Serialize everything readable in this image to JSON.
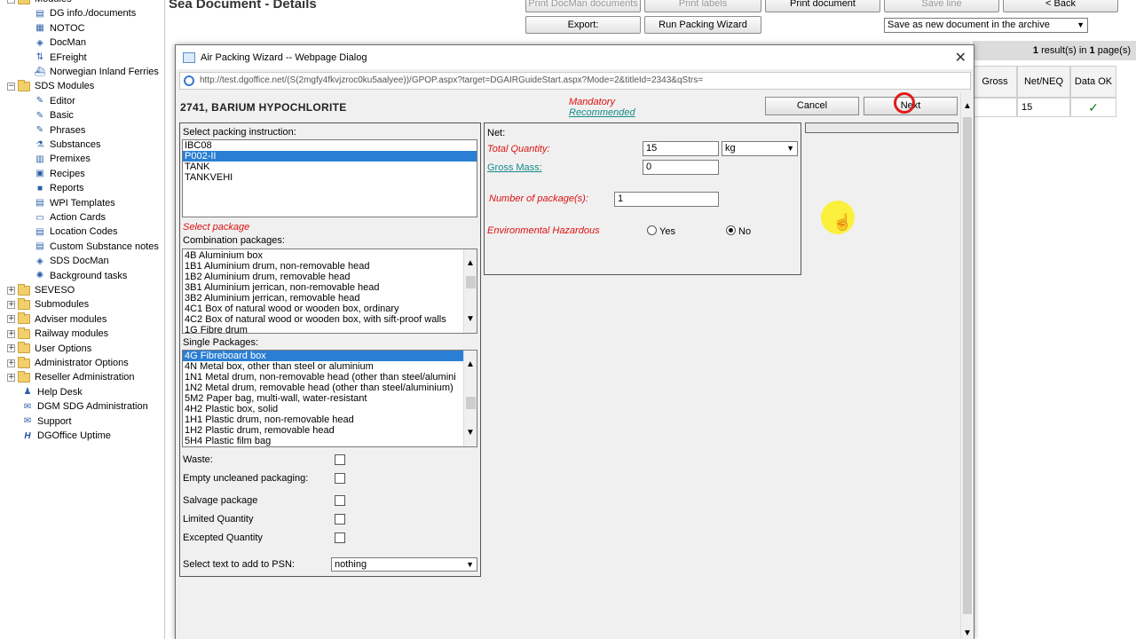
{
  "sidebar": {
    "items": [
      {
        "label": "Modules",
        "kind": "folder",
        "expandable": true
      },
      {
        "label": "DG info./documents",
        "icon": "document-icon"
      },
      {
        "label": "NOTOC",
        "icon": "notoc-icon"
      },
      {
        "label": "DocMan",
        "icon": "docman-icon"
      },
      {
        "label": "EFreight",
        "icon": "arrows-icon"
      },
      {
        "label": "Norwegian Inland Ferries",
        "icon": "ferry-icon"
      },
      {
        "label": "SDS Modules",
        "kind": "folder",
        "expandable": true
      },
      {
        "label": "Editor",
        "icon": "editor-icon"
      },
      {
        "label": "Basic",
        "icon": "basic-icon"
      },
      {
        "label": "Phrases",
        "icon": "phrases-icon"
      },
      {
        "label": "Substances",
        "icon": "substances-icon"
      },
      {
        "label": "Premixes",
        "icon": "premixes-icon"
      },
      {
        "label": "Recipes",
        "icon": "recipes-icon"
      },
      {
        "label": "Reports",
        "icon": "reports-icon"
      },
      {
        "label": "WPI Templates",
        "icon": "templates-icon"
      },
      {
        "label": "Action Cards",
        "icon": "action-cards-icon"
      },
      {
        "label": "Location Codes",
        "icon": "location-icon"
      },
      {
        "label": "Custom Substance notes",
        "icon": "notes-icon"
      },
      {
        "label": "SDS DocMan",
        "icon": "docman-icon"
      },
      {
        "label": "Background tasks",
        "icon": "tasks-icon"
      },
      {
        "label": "SEVESO",
        "kind": "folder",
        "expandable": true
      },
      {
        "label": "Submodules",
        "kind": "folder",
        "expandable": true
      },
      {
        "label": "Adviser modules",
        "kind": "folder",
        "expandable": true
      },
      {
        "label": "Railway modules",
        "kind": "folder",
        "expandable": true
      },
      {
        "label": "User Options",
        "kind": "folder",
        "expandable": true
      },
      {
        "label": "Administrator Options",
        "kind": "folder",
        "expandable": true
      },
      {
        "label": "Reseller Administration",
        "kind": "folder",
        "expandable": true
      },
      {
        "label": "Help Desk",
        "icon": "help-icon"
      },
      {
        "label": "DGM SDG Administration",
        "icon": "admin-icon"
      },
      {
        "label": "Support",
        "icon": "support-icon"
      },
      {
        "label": "DGOffice Uptime",
        "icon": "uptime-icon"
      }
    ]
  },
  "page": {
    "title": "Sea Document - Details",
    "buttons": {
      "print_docman": "Print DocMan documents",
      "print_labels": "Print labels",
      "print_document": "Print document",
      "save_line": "Save line",
      "back": "< Back",
      "export": "Export:",
      "run_wizard": "Run Packing Wizard"
    },
    "save_select": "Save as new document in the archive",
    "results": {
      "count": "1",
      "mid": "result(s) in",
      "pages": "1",
      "suffix": "page(s)"
    },
    "table": {
      "headers": [
        "Gross",
        "Net/NEQ",
        "Data OK"
      ],
      "row": {
        "gross": "",
        "net": "15",
        "ok": "✓"
      }
    }
  },
  "dialog": {
    "title": "Air Packing Wizard -- Webpage Dialog",
    "url": "http://test.dgoffice.net/(S(2mgfy4fkvjzroc0ku5aalyee))/GPOP.aspx?target=DGAIRGuideStart.aspx?Mode=2&titleId=2343&qStrs=",
    "un_title": "2741, BARIUM HYPOCHLORITE",
    "legend": {
      "mandatory": "Mandatory",
      "recommended": "Recommended"
    },
    "cancel": "Cancel",
    "next": "Next",
    "packing": {
      "label": "Select packing instruction:",
      "items": [
        "IBC08",
        "P002-II",
        "TANK",
        "TANKVEHI"
      ],
      "selected": 1
    },
    "select_package": "Select package",
    "combination": {
      "label": "Combination packages:",
      "items": [
        "4B Aluminium box",
        "1B1 Aluminium drum, non-removable head",
        "1B2 Aluminium drum, removable head",
        "3B1 Aluminium jerrican, non-removable head",
        "3B2 Aluminium jerrican, removable head",
        "4C1 Box of natural wood or wooden box, ordinary",
        "4C2 Box of natural wood or wooden box, with sift-proof walls",
        "1G Fibre drum"
      ]
    },
    "single": {
      "label": "Single Packages:",
      "items": [
        "4G Fibreboard box",
        "4N Metal box, other than steel or aluminium",
        "1N1 Metal drum, non-removable head (other than steel/alumini",
        "1N2 Metal drum, removable head (other than steel/aluminium)",
        "5M2 Paper bag, multi-wall, water-resistant",
        "4H2 Plastic box, solid",
        "1H1 Plastic drum, non-removable head",
        "1H2 Plastic drum, removable head",
        "5H4 Plastic film bag"
      ],
      "selected": 0
    },
    "checks": {
      "waste": "Waste:",
      "empty": "Empty uncleaned packaging:",
      "salvage": "Salvage package",
      "limited": "Limited Quantity",
      "excepted": "Excepted Quantity"
    },
    "psn": {
      "label": "Select text to add to PSN:",
      "value": "nothing"
    },
    "net": {
      "header": "Net:",
      "total_label": "Total Quantity:",
      "total_value": "15",
      "unit": "kg",
      "gross_label": "Gross Mass:",
      "gross_value": "0",
      "packages_label": "Number of package(s):",
      "packages_value": "1",
      "env_label": "Environmental Hazardous",
      "yes": "Yes",
      "no": "No",
      "env_selected": "No"
    }
  },
  "colors": {
    "mandatory": "#dd1111",
    "recommended": "#1a8a8a",
    "selection": "#2a7fd4"
  }
}
